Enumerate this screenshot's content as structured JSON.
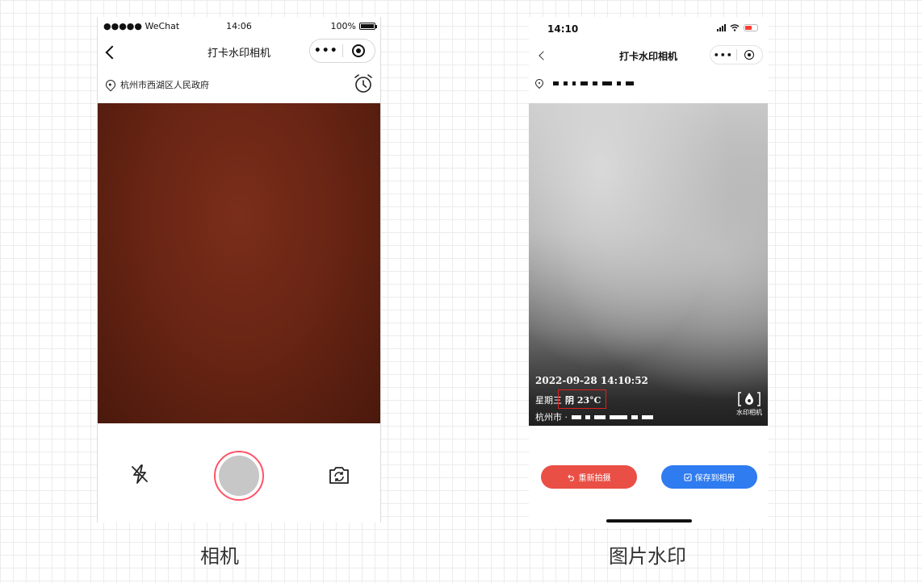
{
  "left_phone": {
    "status": {
      "carrier": "●●●●● WeChat",
      "time": "14:06",
      "battery": "100%"
    },
    "nav": {
      "title": "打卡水印相机",
      "more_label": "•••"
    },
    "location": {
      "text": "杭州市西湖区人民政府"
    },
    "caption": "相机"
  },
  "right_phone": {
    "status": {
      "time": "14:10"
    },
    "nav": {
      "title": "打卡水印相机",
      "more_label": "•••"
    },
    "watermark": {
      "datetime": "2022-09-28 14:10:52",
      "weekday": "星期三",
      "weather": "阴 23°C",
      "city": "杭州市 ·",
      "logo_label": "水印相机"
    },
    "buttons": {
      "retake": "重新拍摄",
      "save": "保存到相册"
    },
    "caption": "图片水印"
  }
}
